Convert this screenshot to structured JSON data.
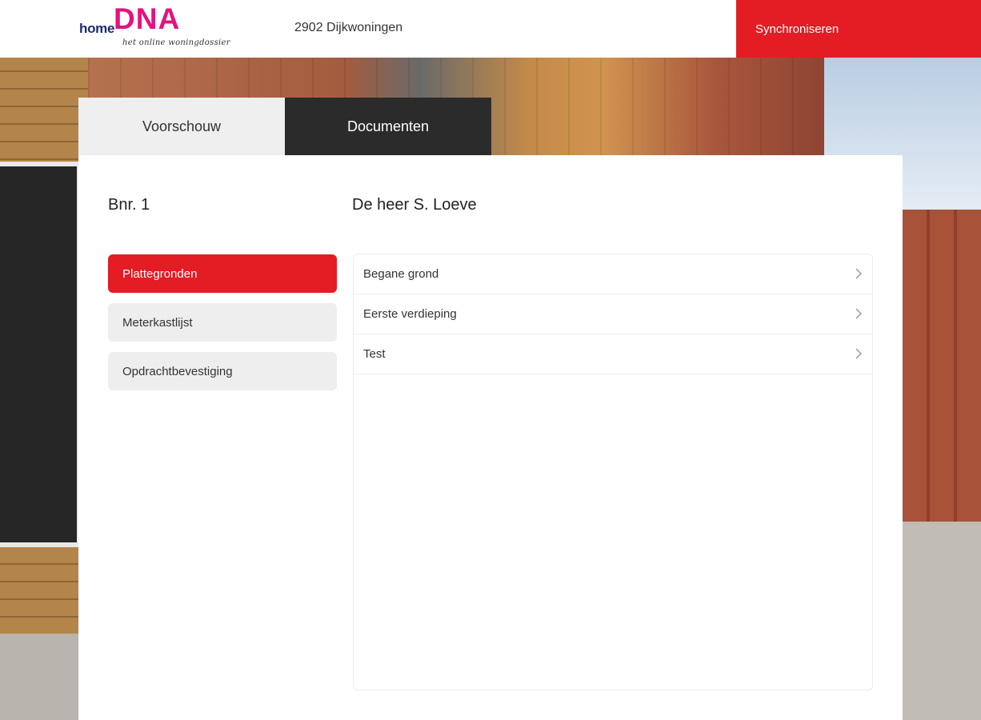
{
  "header": {
    "logo": {
      "home": "home",
      "dna": "DNA",
      "tagline": "het online woningdossier"
    },
    "project": "2902 Dijkwoningen",
    "sync_label": "Synchroniseren"
  },
  "tabs": [
    {
      "label": "Voorschouw",
      "active": false
    },
    {
      "label": "Documenten",
      "active": true
    }
  ],
  "main": {
    "bnr": "Bnr. 1",
    "owner": "De heer S. Loeve"
  },
  "menu": [
    {
      "label": "Plattegronden",
      "active": true
    },
    {
      "label": "Meterkastlijst",
      "active": false
    },
    {
      "label": "Opdrachtbevestiging",
      "active": false
    }
  ],
  "documents": [
    {
      "label": "Begane grond",
      "icon": "chevron-right-icon"
    },
    {
      "label": "Eerste verdieping",
      "icon": "chevron-right-icon"
    },
    {
      "label": "Test",
      "icon": "chevron-right-icon"
    }
  ],
  "colors": {
    "accent": "#e41c24",
    "dna_pink": "#e5127f",
    "tab_active": "#2b2b2b"
  }
}
